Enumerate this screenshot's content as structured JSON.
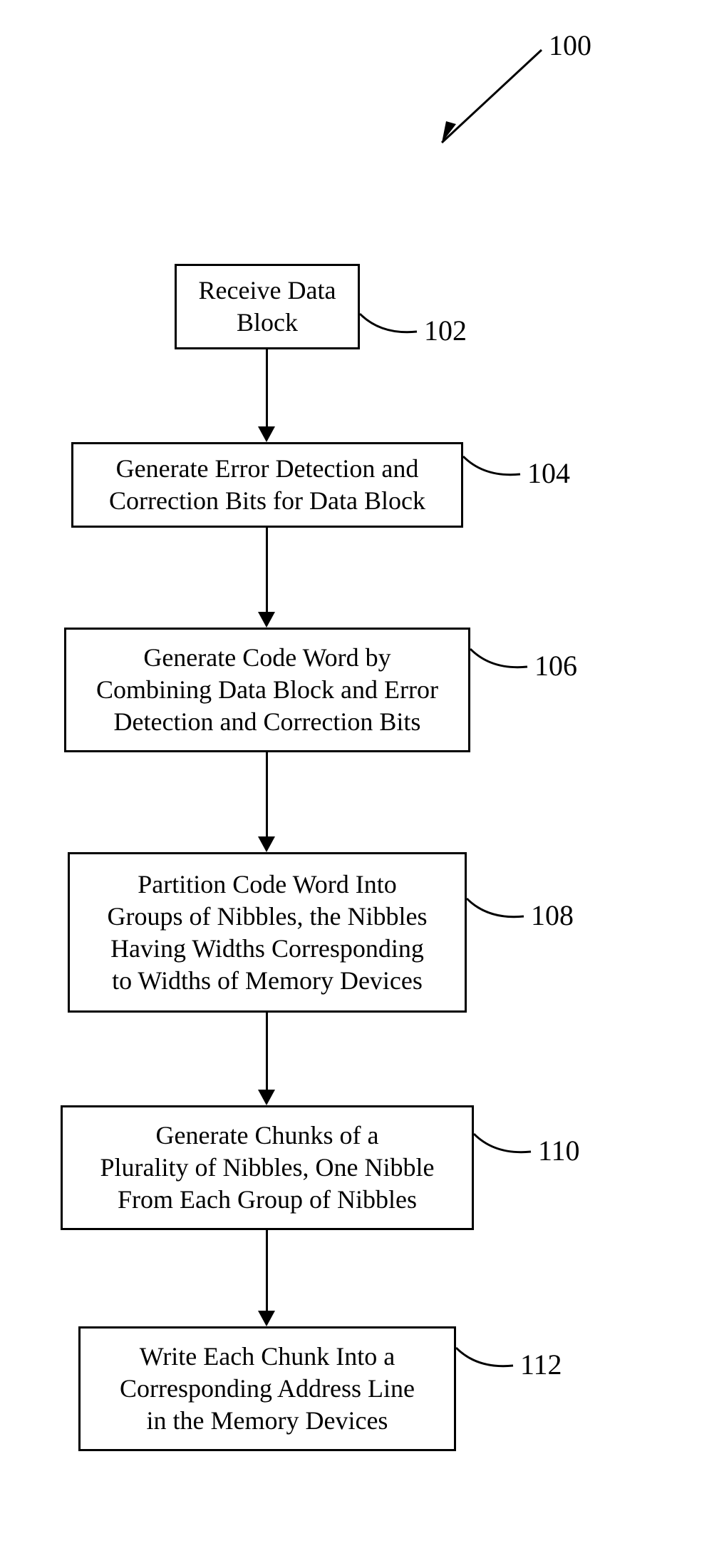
{
  "figure": {
    "ref_100": "100",
    "ref_102": "102",
    "ref_104": "104",
    "ref_106": "106",
    "ref_108": "108",
    "ref_110": "110",
    "ref_112": "112",
    "box_102": "Receive Data\nBlock",
    "box_104": "Generate Error Detection and\nCorrection Bits for Data Block",
    "box_106": "Generate Code Word by\nCombining Data Block and Error\nDetection and Correction Bits",
    "box_108": "Partition Code Word Into\nGroups of Nibbles, the Nibbles\nHaving  Widths Corresponding\nto Widths of Memory Devices",
    "box_110": "Generate Chunks of a\nPlurality of Nibbles, One Nibble\nFrom Each Group of Nibbles",
    "box_112": "Write Each Chunk Into a\nCorresponding Address Line\nin the Memory Devices"
  }
}
